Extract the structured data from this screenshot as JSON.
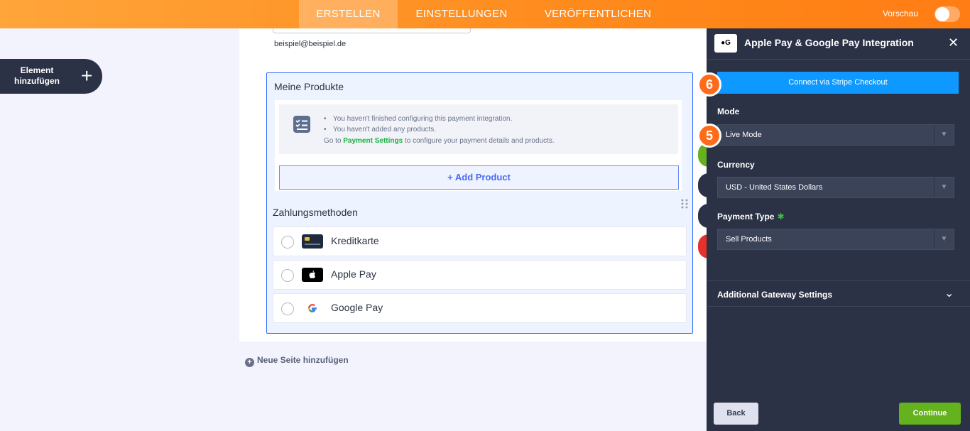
{
  "topbar": {
    "tabs": [
      {
        "label": "ERSTELLEN",
        "active": true
      },
      {
        "label": "EINSTELLUNGEN",
        "active": false
      },
      {
        "label": "VERÖFFENTLICHEN",
        "active": false
      }
    ],
    "preview_label": "Vorschau",
    "preview_on": false
  },
  "sidebar": {
    "add_element_label": "Element hinzufügen"
  },
  "form": {
    "email_sublabel": "beispiel@beispiel.de",
    "products": {
      "title": "Meine Produkte",
      "notice": {
        "line1": "You haven't finished configuring this payment integration.",
        "line2": "You haven't added any products.",
        "line3_pre": "Go to ",
        "line3_link": "Payment Settings",
        "line3_post": " to configure your payment details and products."
      },
      "add_product_label": "+ Add Product"
    },
    "payment_methods": {
      "title": "Zahlungsmethoden",
      "options": [
        {
          "label": "Kreditkarte",
          "icon": "credit-card-icon"
        },
        {
          "label": "Apple Pay",
          "icon": "apple-pay-icon"
        },
        {
          "label": "Google Pay",
          "icon": "google-icon"
        }
      ]
    },
    "new_page_label": "Neue Seite hinzufügen"
  },
  "panel": {
    "title": "Apple Pay & Google Pay Integration",
    "connect_label": "Connect via Stripe Checkout",
    "mode": {
      "label": "Mode",
      "value": "Live Mode"
    },
    "currency": {
      "label": "Currency",
      "value": "USD - United States Dollars"
    },
    "payment_type": {
      "label": "Payment Type",
      "value": "Sell Products"
    },
    "additional_label": "Additional Gateway Settings",
    "back_label": "Back",
    "continue_label": "Continue"
  },
  "steps": {
    "connect": "6",
    "mode": "5"
  },
  "colors": {
    "accent": "#ff7d14",
    "stripe": "#0d99ff",
    "continue": "#64b21e",
    "panel_bg": "#2b3245"
  }
}
